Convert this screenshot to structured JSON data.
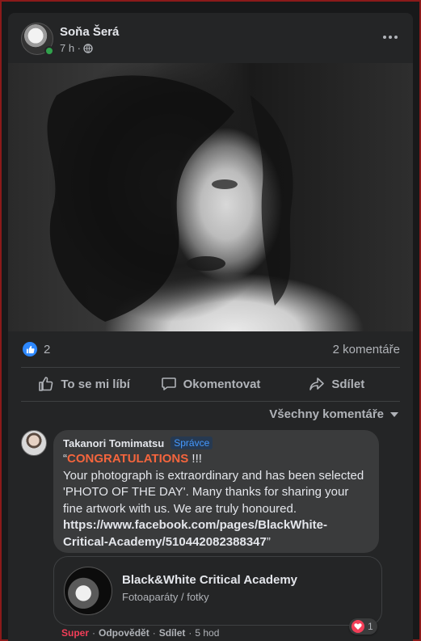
{
  "post": {
    "author": "Soňa Šerá",
    "time": "7 h ·",
    "reactions_count": "2",
    "comments_label": "2 komentáře"
  },
  "actions": {
    "like_label": "To se mi líbí",
    "comment_label": "Okomentovat",
    "share_label": "Sdílet"
  },
  "comments_filter": "Všechny komentáře",
  "comment": {
    "author": "Takanori Tomimatsu",
    "role_badge": "Správce",
    "open_quote": "“",
    "highlight": "CONGRATULATIONS",
    "exclaim": " !!!",
    "body": "Your photograph is extraordinary and has been selected 'PHOTO OF THE DAY'. Many thanks for sharing your fine artwork with us. We are truly honoured.",
    "link": "https://www.facebook.com/pages/BlackWhite-Critical-Academy/510442082388347",
    "close_quote": "”",
    "preview": {
      "title": "Black&White Critical Academy",
      "subtitle": "Fotoaparáty / fotky"
    },
    "actions": {
      "reaction": "Super",
      "reply": "Odpovědět",
      "share": "Sdílet",
      "time": "5 hod",
      "separator": "·"
    },
    "reaction_count": "1"
  },
  "colors": {
    "accent_blue": "#2d88ff",
    "highlight_orange": "#f5653d",
    "love_red": "#f33e58",
    "online_green": "#31a24c"
  },
  "icons": [
    "globe-icon",
    "more-icon",
    "like-icon",
    "thumbs-up-icon",
    "comment-icon",
    "share-icon",
    "chevron-down-icon",
    "heart-icon"
  ]
}
